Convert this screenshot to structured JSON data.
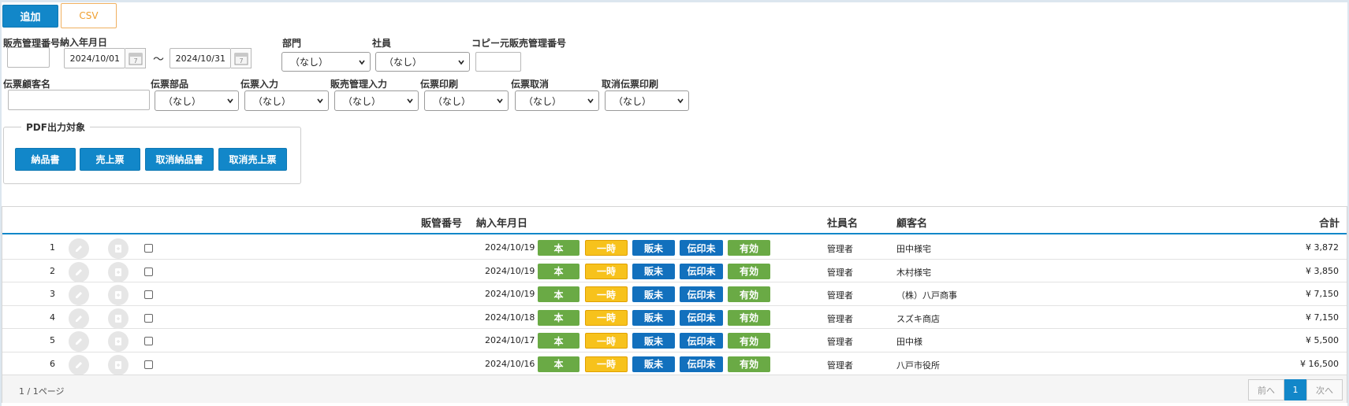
{
  "toolbar": {
    "add_label": "追加",
    "csv_label": "CSV"
  },
  "filters": {
    "sales_no_label": "販売管理番号",
    "delivery_date_label": "納入年月日",
    "date_from": "2024/10/01",
    "date_sep": "～",
    "date_to": "2024/10/31",
    "dept_label": "部門",
    "dept_value": "（なし）",
    "employee_label": "社員",
    "employee_value": "（なし）",
    "copy_src_label": "コピー元販売管理番号",
    "customer_label": "伝票顧客名",
    "slip_part_label": "伝票部品",
    "slip_part_value": "（なし）",
    "slip_input_label": "伝票入力",
    "slip_input_value": "（なし）",
    "sales_input_label": "販売管理入力",
    "sales_input_value": "（なし）",
    "slip_print_label": "伝票印刷",
    "slip_print_value": "（なし）",
    "slip_cancel_label": "伝票取消",
    "slip_cancel_value": "（なし）",
    "cancel_print_label": "取消伝票印刷",
    "cancel_print_value": "（なし）"
  },
  "pdf": {
    "legend": "PDF出力対象",
    "delivery_note": "納品書",
    "sales_slip": "売上票",
    "cancel_delivery_note": "取消納品書",
    "cancel_sales_slip": "取消売上票"
  },
  "table": {
    "headers": {
      "sales_no": "販管番号",
      "delivery_date": "納入年月日",
      "employee": "社員名",
      "customer": "顧客名",
      "total": "合計"
    },
    "tags": [
      "本",
      "一時",
      "販未",
      "伝印未",
      "有効"
    ],
    "rows": [
      {
        "no": "1",
        "date": "2024/10/19",
        "employee": "管理者",
        "customer": "田中様宅",
        "total": "¥ 3,872"
      },
      {
        "no": "2",
        "date": "2024/10/19",
        "employee": "管理者",
        "customer": "木村様宅",
        "total": "¥ 3,850"
      },
      {
        "no": "3",
        "date": "2024/10/19",
        "employee": "管理者",
        "customer": "（株）八戸商事",
        "total": "¥ 7,150"
      },
      {
        "no": "4",
        "date": "2024/10/18",
        "employee": "管理者",
        "customer": "スズキ商店",
        "total": "¥ 7,150"
      },
      {
        "no": "5",
        "date": "2024/10/17",
        "employee": "管理者",
        "customer": "田中様",
        "total": "¥ 5,500"
      },
      {
        "no": "6",
        "date": "2024/10/16",
        "employee": "管理者",
        "customer": "八戸市役所",
        "total": "¥ 16,500"
      }
    ]
  },
  "pagination": {
    "info": "1 / 1ページ",
    "prev": "前へ",
    "current": "1",
    "next": "次へ"
  },
  "colors": {
    "primary": "#1287c9",
    "green": "#6aaa45",
    "yellow": "#f7c21c",
    "blue": "#1270bd"
  }
}
